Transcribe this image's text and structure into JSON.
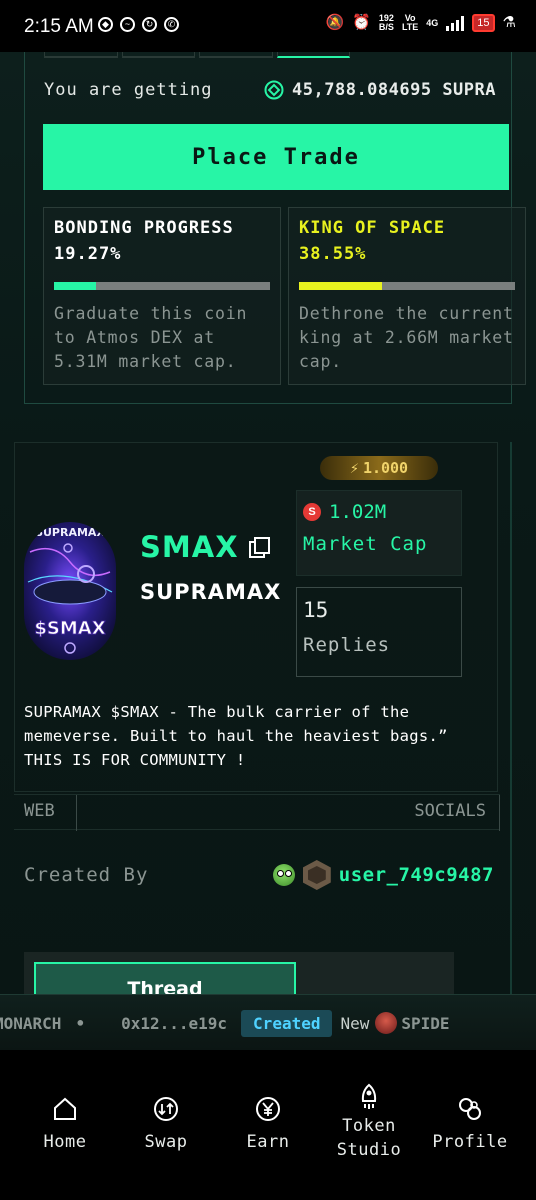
{
  "status_bar": {
    "time": "2:15 AM",
    "net_speed_top": "192",
    "net_speed_bottom": "B/S",
    "volte_top": "Vo",
    "volte_bottom": "LTE",
    "network": "4G",
    "battery": "15"
  },
  "trade": {
    "getting_label": "You are getting",
    "getting_amount": "45,788.084695 SUPRA",
    "place_trade_label": "Place Trade"
  },
  "bonding": {
    "title": "BONDING PROGRESS",
    "percent": "19.27%",
    "progress": 0.1927,
    "description": "Graduate this coin to Atmos DEX at 5.31M market cap.",
    "color": "#27f5a6"
  },
  "king": {
    "title": "KING OF SPACE",
    "percent": "38.55%",
    "progress": 0.3855,
    "description": "Dethrone the current king at 2.66M market cap.",
    "color": "#e8f21f"
  },
  "token": {
    "power": "1.000",
    "ticker": "SMAX",
    "name": "SUPRAMAX",
    "image_top_text": "SUPRAMAX",
    "image_bottom_text": "$SMAX",
    "market_cap_value": "1.02M",
    "market_cap_label": "Market Cap",
    "replies_count": "15",
    "replies_label": "Replies",
    "description": "SUPRAMAX $SMAX - The bulk carrier of the memeverse. Built to haul the heaviest bags.” THIS IS FOR COMMUNITY !"
  },
  "links": {
    "web": "WEB",
    "socials": "SOCIALS"
  },
  "creator": {
    "label": "Created By",
    "username": "user_749c9487"
  },
  "thread_tab": "Thread",
  "strip": {
    "item1": "MONARCH",
    "dot": "•",
    "address": "0x12...e19c",
    "created": "Created",
    "new": "New",
    "item2": "SPIDE"
  },
  "nav": [
    {
      "label": "Home",
      "icon": "home-icon"
    },
    {
      "label": "Swap",
      "icon": "swap-icon"
    },
    {
      "label": "Earn",
      "icon": "earn-icon"
    },
    {
      "label": "Token Studio",
      "icon": "rocket-icon"
    },
    {
      "label": "Profile",
      "icon": "profile-icon"
    }
  ],
  "colors": {
    "accent": "#27f5a6",
    "king": "#e8f21f",
    "background": "#0a1917"
  }
}
